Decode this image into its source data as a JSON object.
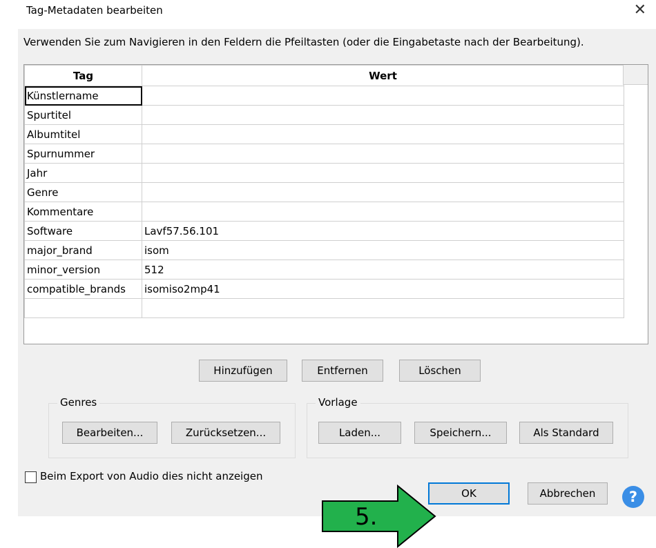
{
  "window": {
    "title": "Tag-Metadaten bearbeiten",
    "close_glyph": "✕"
  },
  "instruction": "Verwenden Sie zum Navigieren in den Feldern die Pfeiltasten (oder die Eingabetaste nach der Bearbeitung).",
  "grid": {
    "headers": {
      "tag": "Tag",
      "value": "Wert"
    },
    "rows": [
      {
        "tag": "Künstlername",
        "value": ""
      },
      {
        "tag": "Spurtitel",
        "value": ""
      },
      {
        "tag": "Albumtitel",
        "value": ""
      },
      {
        "tag": "Spurnummer",
        "value": ""
      },
      {
        "tag": "Jahr",
        "value": ""
      },
      {
        "tag": "Genre",
        "value": ""
      },
      {
        "tag": "Kommentare",
        "value": ""
      },
      {
        "tag": "Software",
        "value": "Lavf57.56.101"
      },
      {
        "tag": "major_brand",
        "value": "isom"
      },
      {
        "tag": "minor_version",
        "value": "512"
      },
      {
        "tag": "compatible_brands",
        "value": "isomiso2mp41"
      },
      {
        "tag": "",
        "value": ""
      }
    ]
  },
  "actions": {
    "add": "Hinzufügen",
    "remove": "Entfernen",
    "clear": "Löschen"
  },
  "genres": {
    "label": "Genres",
    "edit": "Bearbeiten...",
    "reset": "Zurücksetzen..."
  },
  "template": {
    "label": "Vorlage",
    "load": "Laden...",
    "save": "Speichern...",
    "default": "Als Standard"
  },
  "checkbox": {
    "label": "Beim Export von Audio dies nicht anzeigen",
    "checked": false
  },
  "footer": {
    "ok": "OK",
    "cancel": "Abbrechen",
    "help_glyph": "?"
  },
  "annotation": {
    "label": "5.",
    "color": "#22b14c"
  }
}
